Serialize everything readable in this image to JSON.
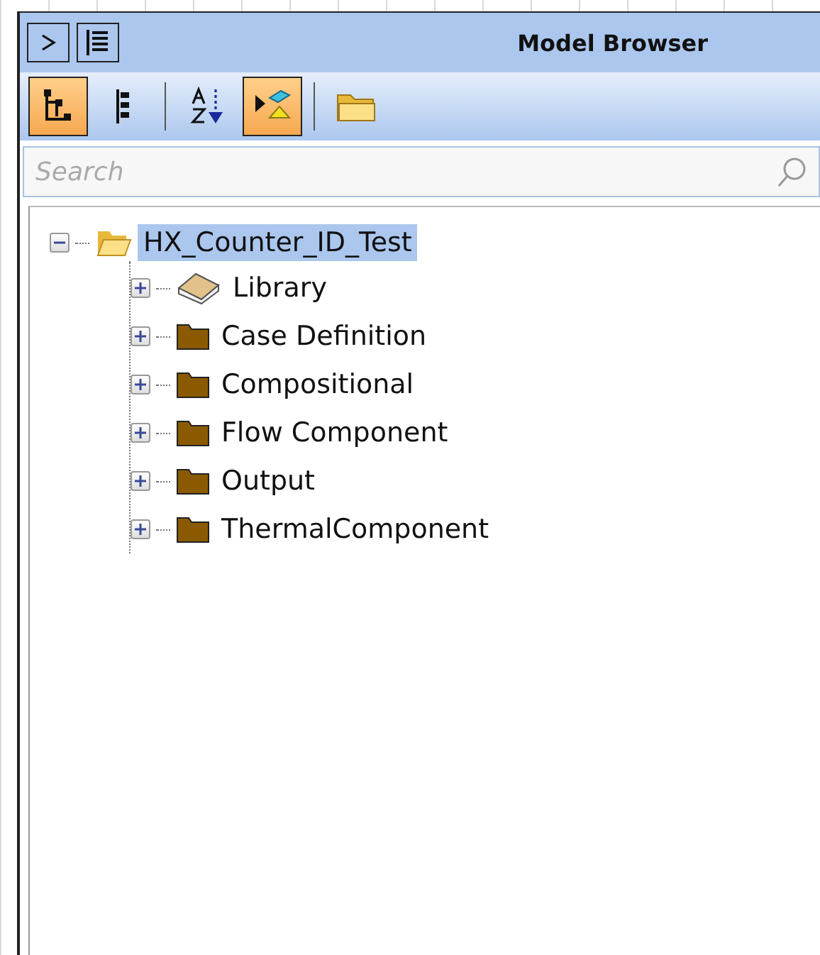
{
  "window": {
    "title": "Model Browser"
  },
  "toolbar": [
    {
      "kind": "toggle",
      "selected": true
    },
    {
      "kind": "toggle",
      "selected": false
    },
    {
      "kind": "separator"
    },
    {
      "kind": "toggle",
      "selected": false
    },
    {
      "kind": "toggle",
      "selected": true
    },
    {
      "kind": "separator"
    },
    {
      "kind": "button"
    }
  ],
  "search": {
    "placeholder": "Search"
  },
  "tree": [
    {
      "label": "HX_Counter_ID_Test",
      "kind": "project",
      "expanded": true,
      "selected": true,
      "children": [
        {
          "label": "Library",
          "kind": "book",
          "expanded": false,
          "selected": false
        },
        {
          "label": "Case Definition",
          "kind": "folder",
          "expanded": false,
          "selected": false
        },
        {
          "label": "Compositional",
          "kind": "folder",
          "expanded": false,
          "selected": false
        },
        {
          "label": "Flow Component",
          "kind": "folder",
          "expanded": false,
          "selected": false
        },
        {
          "label": "Output",
          "kind": "folder",
          "expanded": false,
          "selected": false
        },
        {
          "label": "ThermalComponent",
          "kind": "folder",
          "expanded": false,
          "selected": false
        }
      ]
    }
  ]
}
